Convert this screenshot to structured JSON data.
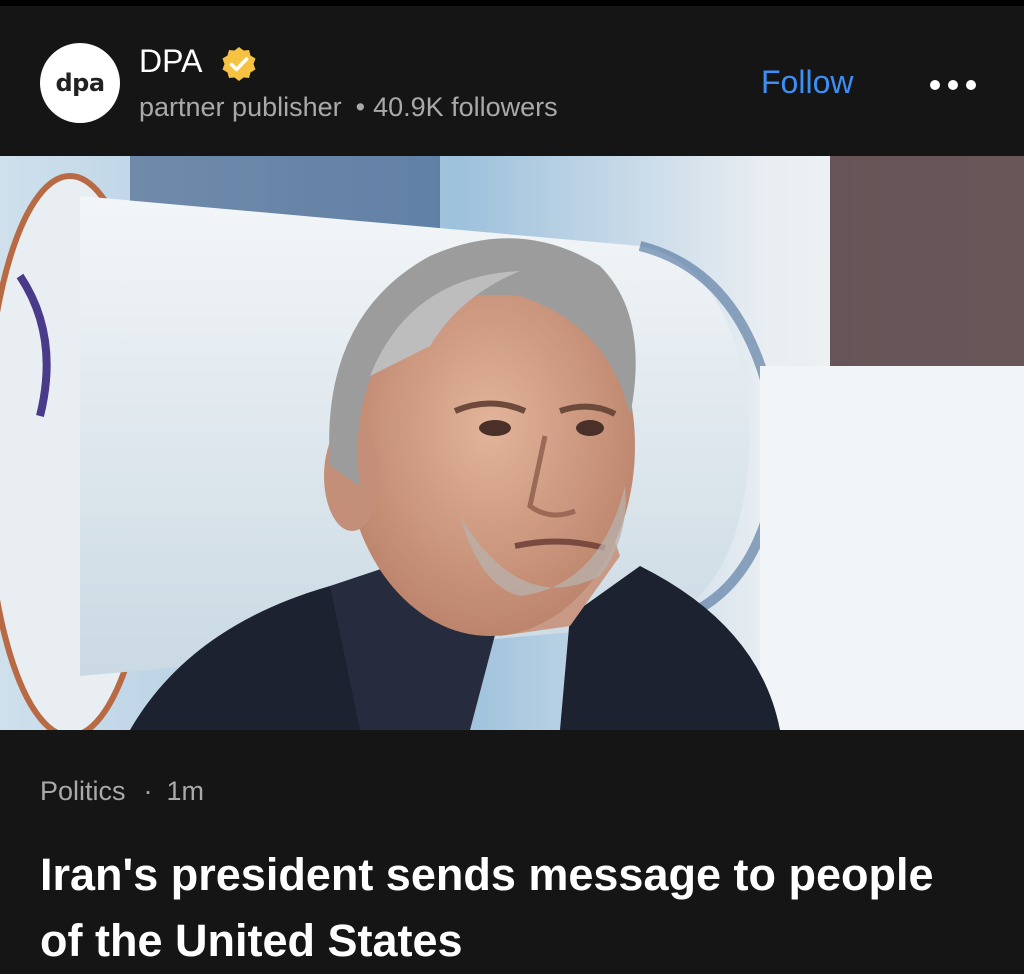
{
  "publisher": {
    "logo_text": "dpa",
    "name": "DPA",
    "badge_icon": "verified-badge-icon",
    "badge_color": "#f5c241",
    "type": "partner publisher",
    "separator": "•",
    "followers": "40.9K followers",
    "follow_label": "Follow",
    "follow_color": "#3b8ff5",
    "more_icon": "more-options-icon"
  },
  "article": {
    "image_alt": "Iran's president in front of a missile display",
    "category": "Politics",
    "separator": "·",
    "time": "1m",
    "headline": "Iran's president sends message to people of the United States"
  }
}
